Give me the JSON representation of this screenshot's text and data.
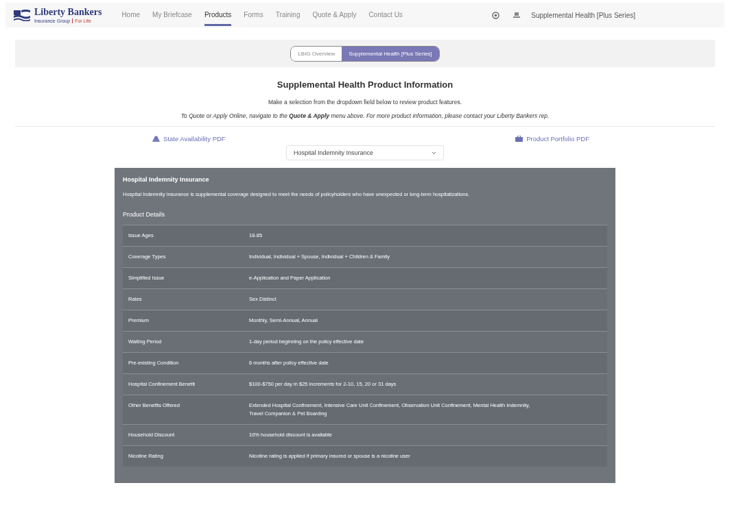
{
  "brand": {
    "name": "Liberty Bankers",
    "tagline": "Insurance Group",
    "tagline_accent": "For Life"
  },
  "nav": [
    {
      "label": "Home",
      "selected": false
    },
    {
      "label": "My Briefcase",
      "selected": false
    },
    {
      "label": "Products",
      "selected": true
    },
    {
      "label": "Forms",
      "selected": false
    },
    {
      "label": "Training",
      "selected": false
    },
    {
      "label": "Quote & Apply",
      "selected": false
    },
    {
      "label": "Contact Us",
      "selected": false
    }
  ],
  "user_product": "Supplemental Health [Plus Series]",
  "tabs": [
    {
      "label": "LBIG Overview",
      "selected": false
    },
    {
      "label": "Supplemental Health [Plus Series]",
      "selected": true
    }
  ],
  "title": "Supplemental Health Product Information",
  "instruction": "Make a selection from the dropdown field below to review product features.",
  "note": "To Quote or Apply Online, navigate to the **Quote & Apply** menu above. For more product information, please contact your Liberty Bankers rep.",
  "links": [
    {
      "label": "State Availability PDF",
      "kind": "map"
    },
    {
      "label": "Product Portfolio PDF",
      "kind": "briefcase"
    }
  ],
  "product_select": {
    "value": "Hospital Indemnity Insurance"
  },
  "product": {
    "name": "Hospital Indemnity Insurance",
    "description": "Hospital Indemnity insurance is supplemental coverage designed to meet the needs of policyholders who have unexpected or long-term hospitalizations.",
    "details_heading": "Product Details",
    "rows": [
      {
        "label": "Issue Ages",
        "value": "18-85"
      },
      {
        "label": "Coverage Types",
        "value": "Individual, Individual + Spouse, Individual + Children & Family"
      },
      {
        "label": "Simplified Issue",
        "value": "e-Application and Paper Application"
      },
      {
        "label": "Rates",
        "value": "Sex Distinct"
      },
      {
        "label": "Premium",
        "value": "Monthly, Semi-Annual, Annual"
      },
      {
        "label": "Waiting Period",
        "value": "1-day period beginning on the policy effective date"
      },
      {
        "label": "Pre-existing Condition",
        "value": "6 months after policy effective date"
      },
      {
        "label": "Hospital Confinement Benefit",
        "value": "$100-$750 per day in $25 increments for 2-10, 15, 20 or 31 days"
      },
      {
        "label": "Other Benefits Offered",
        "value": "Extended Hospital Confinement, Intensive Care Unit Confinement, Observation Unit Confinement, Mental Health Indemnity, Travel Companion & Pet Boarding"
      },
      {
        "label": "Household Discount",
        "value": "10% household discount is available"
      },
      {
        "label": "Nicotine Rating",
        "value": "Nicotine rating is applied if primary insured or spouse is a nicotine user"
      }
    ]
  }
}
